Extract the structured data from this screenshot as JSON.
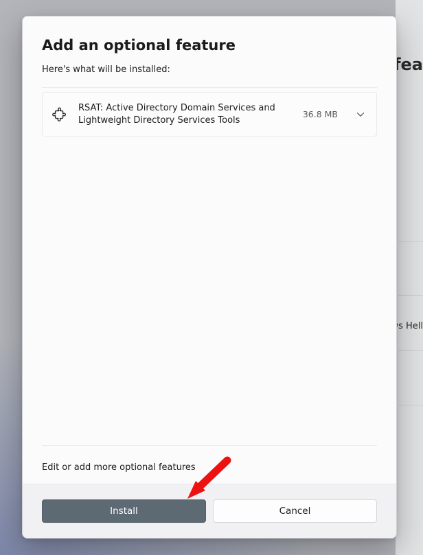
{
  "background": {
    "partial_heading": "fea",
    "partial_row_text": "ws Hell"
  },
  "dialog": {
    "title": "Add an optional feature",
    "subtitle": "Here's what will be installed:",
    "features": [
      {
        "name": "RSAT: Active Directory Domain Services and Lightweight Directory Services Tools",
        "size": "36.8 MB"
      }
    ],
    "edit_link": "Edit or add more optional features",
    "buttons": {
      "install": "Install",
      "cancel": "Cancel"
    }
  }
}
